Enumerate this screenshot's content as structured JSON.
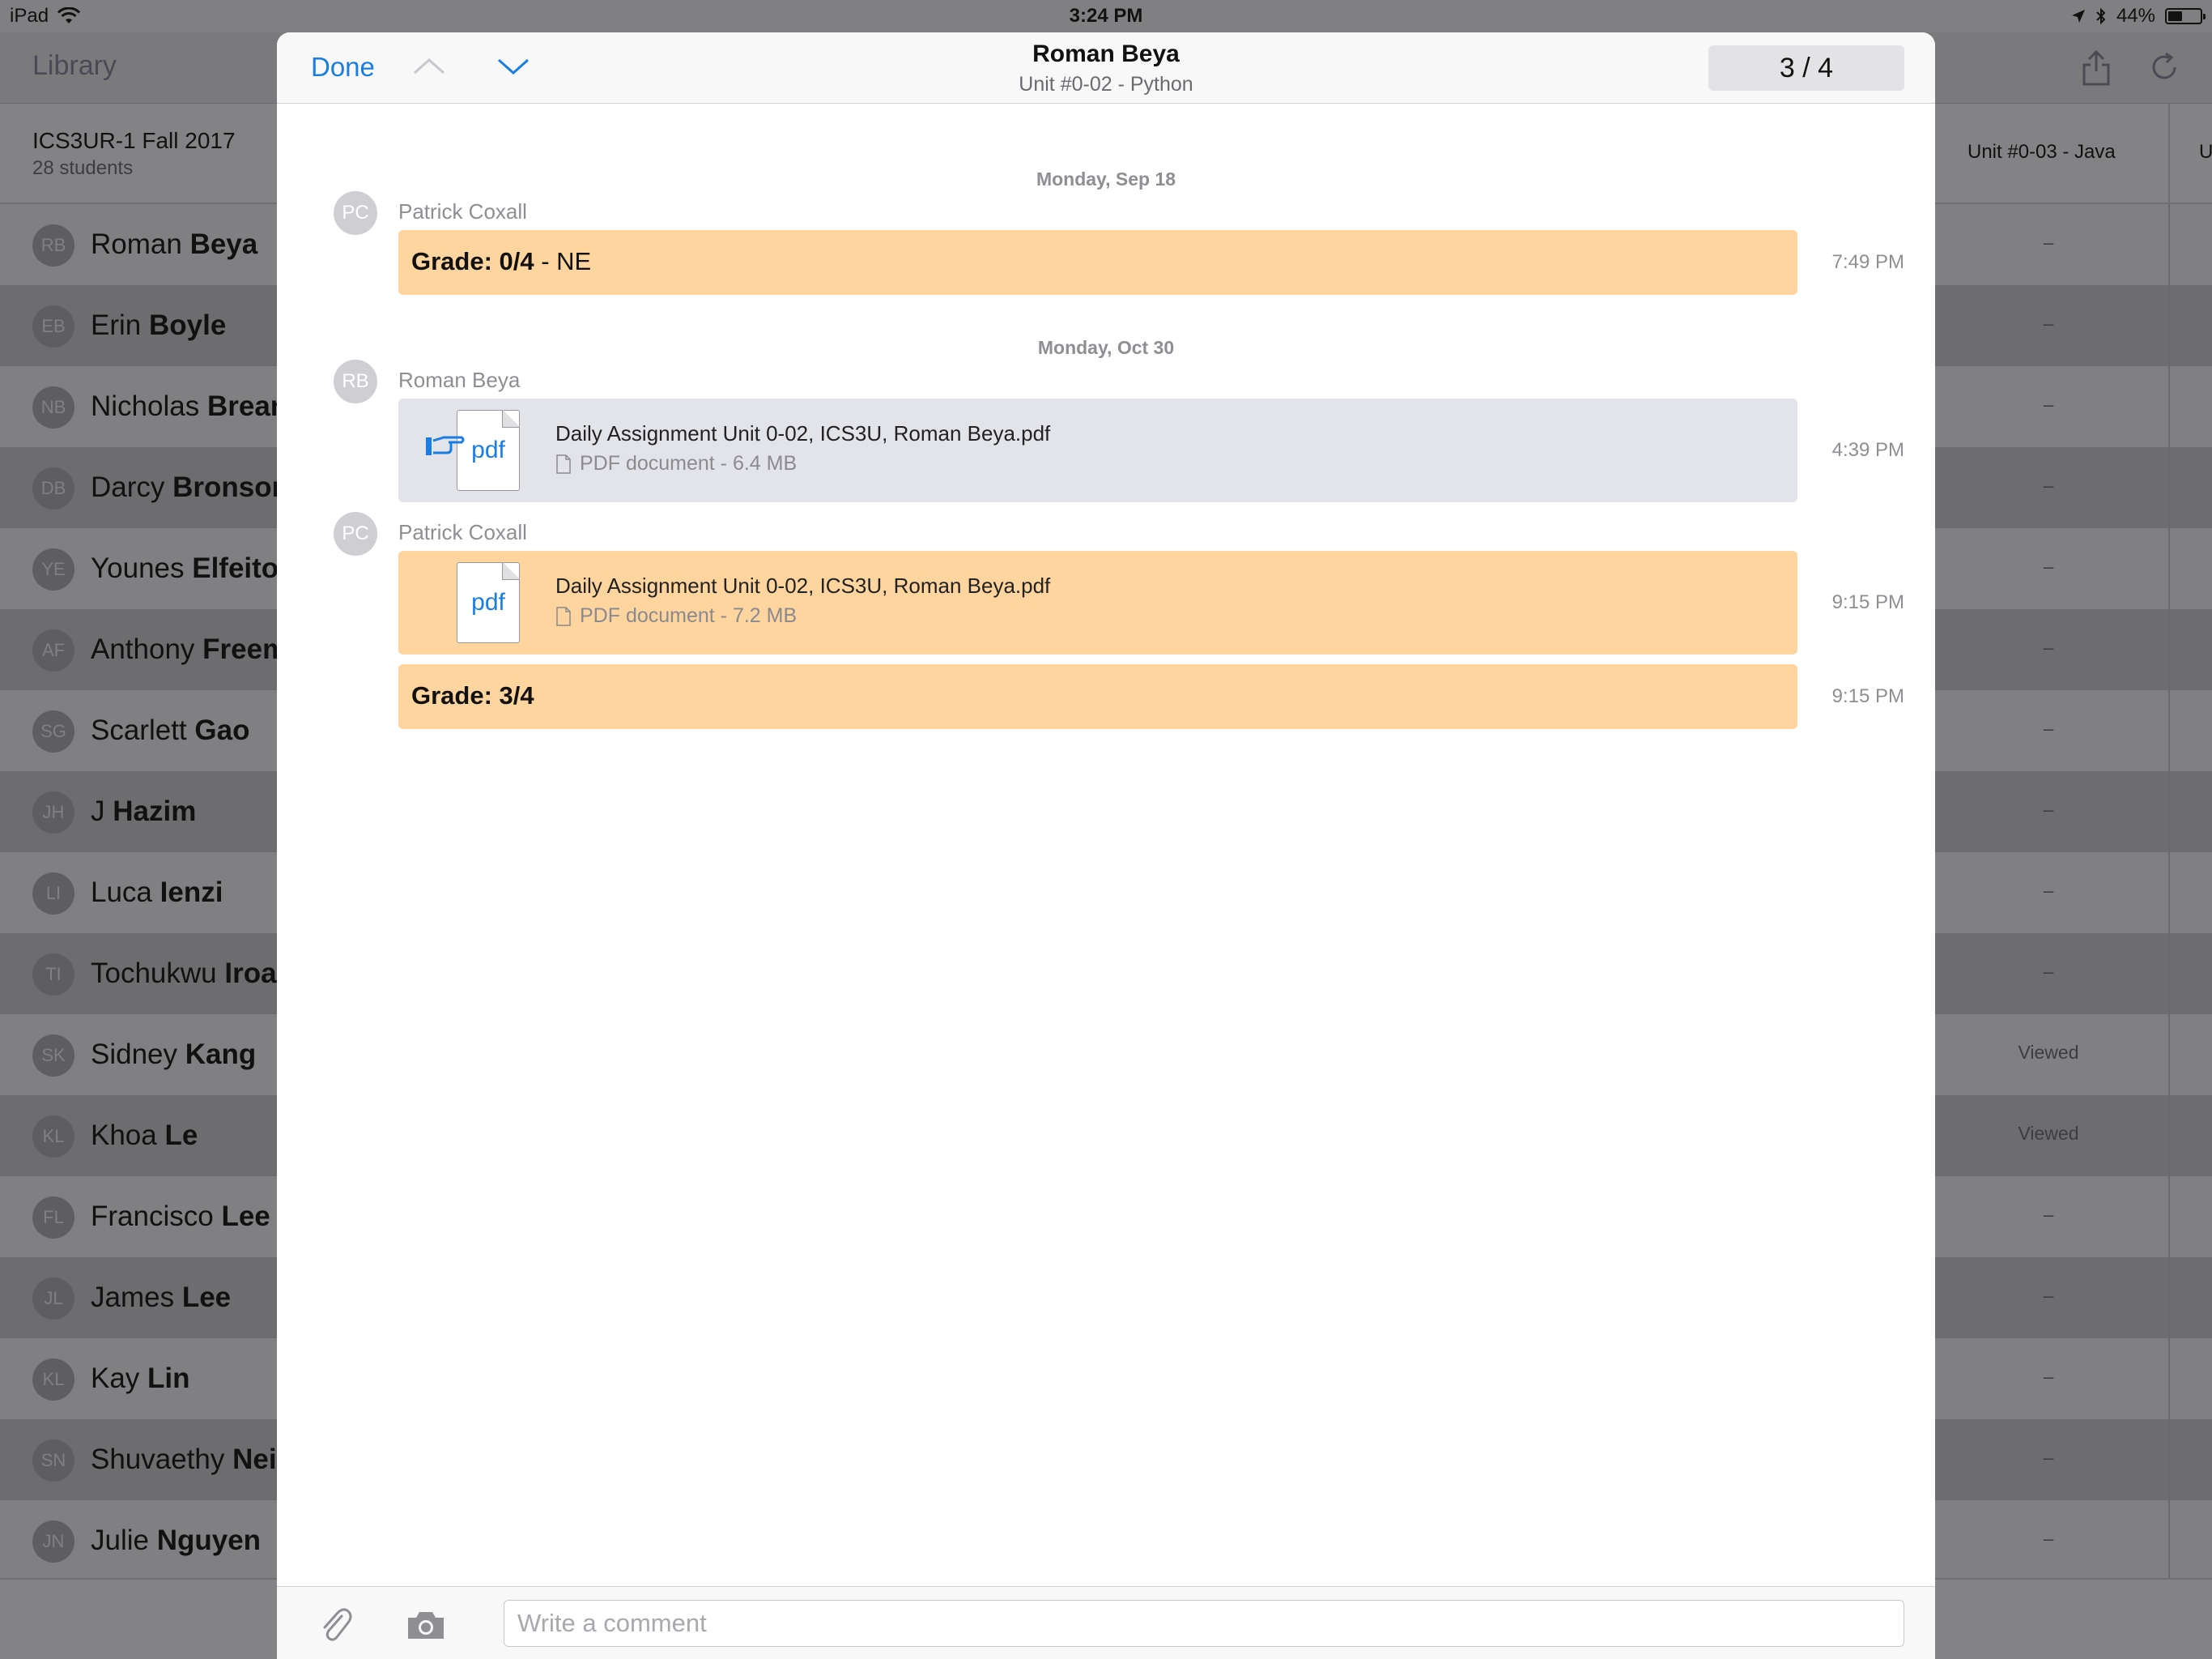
{
  "status_bar": {
    "device": "iPad",
    "time": "3:24 PM",
    "battery": "44%",
    "battery_level": 0.44
  },
  "background": {
    "nav": {
      "library": "Library"
    },
    "course": {
      "name": "ICS3UR-1 Fall 2017",
      "students": "28 students"
    },
    "columns": [
      "Unit #0-03 - Java",
      "U"
    ],
    "students": [
      {
        "initials": "RB",
        "first": "Roman",
        "last": "Beya",
        "status": "–"
      },
      {
        "initials": "EB",
        "first": "Erin",
        "last": "Boyle",
        "status": "–"
      },
      {
        "initials": "NB",
        "first": "Nicholas",
        "last": "Brean",
        "status": "–"
      },
      {
        "initials": "DB",
        "first": "Darcy",
        "last": "Bronson",
        "status": "–"
      },
      {
        "initials": "YE",
        "first": "Younes",
        "last": "Elfeitor",
        "status": "–"
      },
      {
        "initials": "AF",
        "first": "Anthony",
        "last": "Freem",
        "status": "–"
      },
      {
        "initials": "SG",
        "first": "Scarlett",
        "last": "Gao",
        "status": "–"
      },
      {
        "initials": "JH",
        "first": "J",
        "last": "Hazim",
        "status": "–"
      },
      {
        "initials": "LI",
        "first": "Luca",
        "last": "Ienzi",
        "status": "–"
      },
      {
        "initials": "TI",
        "first": "Tochukwu",
        "last": "Iroal",
        "status": "–"
      },
      {
        "initials": "SK",
        "first": "Sidney",
        "last": "Kang",
        "status": "Viewed"
      },
      {
        "initials": "KL",
        "first": "Khoa",
        "last": "Le",
        "status": "Viewed"
      },
      {
        "initials": "FL",
        "first": "Francisco",
        "last": "Lee",
        "status": "–"
      },
      {
        "initials": "JL",
        "first": "James",
        "last": "Lee",
        "status": "–"
      },
      {
        "initials": "KL",
        "first": "Kay",
        "last": "Lin",
        "status": "–"
      },
      {
        "initials": "SN",
        "first": "Shuvaethy",
        "last": "Neil",
        "status": "–"
      },
      {
        "initials": "JN",
        "first": "Julie",
        "last": "Nguyen",
        "status": "–"
      }
    ]
  },
  "modal": {
    "done_label": "Done",
    "title": "Roman Beya",
    "subtitle": "Unit #0-02 - Python",
    "counter": "3 / 4",
    "feed": {
      "date1": "Monday, Sep 18",
      "author1": {
        "initials": "PC",
        "name": "Patrick Coxall"
      },
      "grade1": {
        "text": "Grade: 0/4",
        "suffix": " - NE",
        "time": "7:49 PM"
      },
      "date2": "Monday, Oct 30",
      "author2": {
        "initials": "RB",
        "name": "Roman Beya"
      },
      "file1": {
        "icon_label": "pdf",
        "name": "Daily Assignment Unit 0-02, ICS3U, Roman Beya.pdf",
        "meta": "PDF document - 6.4 MB",
        "time": "4:39 PM"
      },
      "author3": {
        "initials": "PC",
        "name": "Patrick Coxall"
      },
      "file2": {
        "icon_label": "pdf",
        "name": "Daily Assignment Unit 0-02, ICS3U, Roman Beya.pdf",
        "meta": "PDF document - 7.2 MB",
        "time": "9:15 PM"
      },
      "grade2": {
        "text": "Grade: 3/4",
        "time": "9:15 PM"
      }
    },
    "composer": {
      "placeholder": "Write a comment"
    }
  },
  "colors": {
    "accent": "#1a7de4",
    "teacher_bubble": "#fed49f",
    "student_bubble": "#e3e4ea"
  }
}
